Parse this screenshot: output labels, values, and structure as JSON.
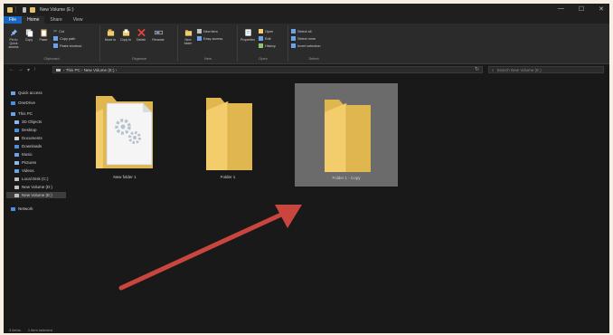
{
  "window": {
    "title": "New Volume (E:)",
    "controls": [
      "—",
      "☐",
      "✕"
    ]
  },
  "ribbon_tabs": [
    {
      "label": "File"
    },
    {
      "label": "Home"
    },
    {
      "label": "Share"
    },
    {
      "label": "View"
    }
  ],
  "ribbon": {
    "clipboard": {
      "label": "Clipboard",
      "pin": "Pin to Quick access",
      "copy": "Copy",
      "paste": "Paste",
      "cut": "Cut",
      "copy_path": "Copy path",
      "paste_shortcut": "Paste shortcut"
    },
    "organize": {
      "label": "Organize",
      "move_to": "Move to",
      "copy_to": "Copy to",
      "delete": "Delete",
      "rename": "Rename"
    },
    "new": {
      "label": "New",
      "new_folder": "New folder",
      "new_item": "New item",
      "easy_access": "Easy access"
    },
    "open": {
      "label": "Open",
      "properties": "Properties",
      "open": "Open",
      "edit": "Edit",
      "history": "History"
    },
    "select": {
      "label": "Select",
      "select_all": "Select all",
      "select_none": "Select none",
      "invert_selection": "Invert selection"
    }
  },
  "address": {
    "path": [
      "This PC",
      "New Volume (E:)"
    ],
    "search_placeholder": "Search New Volume (E:)"
  },
  "nav_pane": [
    {
      "label": "Quick access",
      "icon": "star-icon"
    },
    {
      "label": "OneDrive",
      "icon": "cloud-icon"
    },
    {
      "label": "This PC",
      "icon": "computer-icon"
    },
    {
      "label": "3D Objects",
      "icon": "cube-icon"
    },
    {
      "label": "Desktop",
      "icon": "desktop-icon"
    },
    {
      "label": "Documents",
      "icon": "documents-icon"
    },
    {
      "label": "Downloads",
      "icon": "download-icon"
    },
    {
      "label": "Music",
      "icon": "music-icon"
    },
    {
      "label": "Pictures",
      "icon": "pictures-icon"
    },
    {
      "label": "Videos",
      "icon": "videos-icon"
    },
    {
      "label": "Local Disk (C:)",
      "icon": "drive-icon"
    },
    {
      "label": "New Volume (D:)",
      "icon": "drive-icon"
    },
    {
      "label": "New Volume (E:)",
      "icon": "drive-icon",
      "selected": true
    },
    {
      "label": "Network",
      "icon": "network-icon"
    }
  ],
  "files": [
    {
      "label": "New folder 1",
      "type": "folder-with-document"
    },
    {
      "label": "Folder 1",
      "type": "folder"
    },
    {
      "label": "Folder 1 - Copy",
      "type": "folder",
      "selected": true
    }
  ],
  "status": {
    "items": "3 items",
    "selected": "1 item selected"
  },
  "colors": {
    "accent": "#1a66c2",
    "folder": "#f3cd6c",
    "arrow": "#c9463f",
    "selection": "#6b6b6b"
  }
}
